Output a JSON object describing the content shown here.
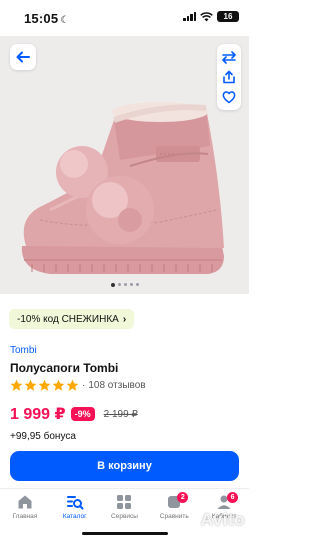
{
  "status_bar": {
    "time": "15:05",
    "battery": "16"
  },
  "gallery": {
    "image_name": "pink-suede-boot-with-pompoms",
    "image_count": 5,
    "active_index": 0
  },
  "promo": {
    "text": "-10% код СНЕЖИНКА"
  },
  "product": {
    "brand": "Tombi",
    "title": "Полусапоги Tombi",
    "rating": 5,
    "reviews": "108 отзывов",
    "price": "1 999 ₽",
    "discount": "-9%",
    "old_price": "2 199 ₽",
    "bonus": "+99,95 бонуса"
  },
  "cart_button": {
    "label": "В корзину"
  },
  "tab_bar": {
    "tabs": [
      {
        "label": "Главная",
        "icon": "home-icon"
      },
      {
        "label": "Каталог",
        "icon": "catalog-icon"
      },
      {
        "label": "Сервисы",
        "icon": "services-icon"
      },
      {
        "label": "Сравнить",
        "icon": "compare-icon",
        "badge": "2"
      },
      {
        "label": "Кабинет",
        "icon": "profile-icon",
        "badge": "6"
      }
    ]
  },
  "watermark": "Avito",
  "colors": {
    "accent": "#005bff",
    "price": "#f91155",
    "promo_bg": "#f1f7d9"
  }
}
